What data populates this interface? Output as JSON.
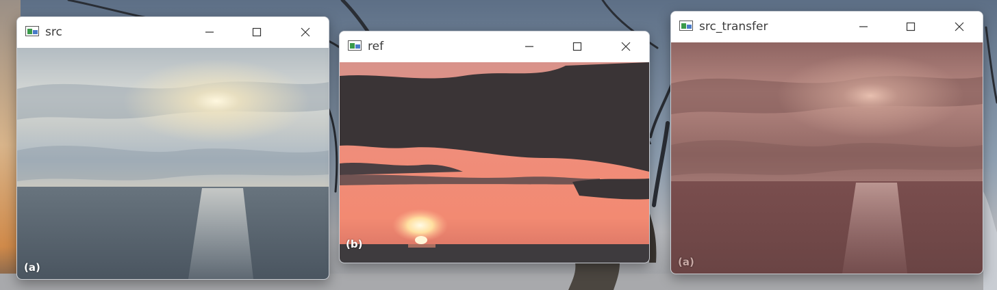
{
  "windows": [
    {
      "id": "src",
      "title": "src",
      "label": "(a)",
      "controls": {
        "minimize": "minimize-icon",
        "maximize": "maximize-icon",
        "close": "close-icon"
      }
    },
    {
      "id": "ref",
      "title": "ref",
      "label": "(b)",
      "controls": {
        "minimize": "minimize-icon",
        "maximize": "maximize-icon",
        "close": "close-icon"
      }
    },
    {
      "id": "src_transfer",
      "title": "src_transfer",
      "label": "(a)",
      "controls": {
        "minimize": "minimize-icon",
        "maximize": "maximize-icon",
        "close": "close-icon"
      }
    }
  ],
  "colors": {
    "titlebar_bg": "#ffffff",
    "title_text": "#3b3b3b",
    "src_sky": "#c9cdd0",
    "src_sea": "#52606c",
    "ref_sky": "#f08c7a",
    "ref_clouds": "#3a3436",
    "transfer_tint": "#8a5a58"
  }
}
